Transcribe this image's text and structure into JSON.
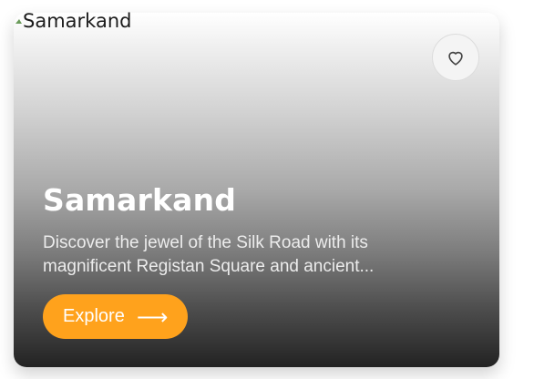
{
  "image_alt": "Samarkand",
  "card": {
    "title": "Samarkand",
    "description": "Discover the jewel of the Silk Road with its magnificent Registan Square and ancient...",
    "cta_label": "Explore",
    "cta_arrow": "⟶",
    "favorite_icon": "heart-outline-icon"
  },
  "colors": {
    "accent": "#ffa21c",
    "title_text": "#ffffff",
    "description_text": "#ececec"
  }
}
